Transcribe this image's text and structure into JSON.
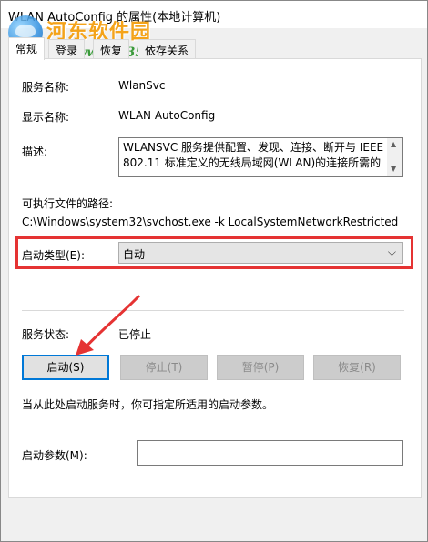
{
  "window": {
    "title": "WLAN AutoConfig 的属性(本地计算机)"
  },
  "watermark": {
    "name": "河东软件园",
    "url": "www.pc0359.cn"
  },
  "tabs": [
    {
      "label": "常规"
    },
    {
      "label": "登录"
    },
    {
      "label": "恢复"
    },
    {
      "label": "依存关系"
    }
  ],
  "general": {
    "service_name_label": "服务名称:",
    "service_name_value": "WlanSvc",
    "display_name_label": "显示名称:",
    "display_name_value": "WLAN AutoConfig",
    "description_label": "描述:",
    "description_value": "WLANSVC 服务提供配置、发现、连接、断开与 IEEE 802.11 标准定义的无线局域网(WLAN)的连接所需的",
    "exe_path_label": "可执行文件的路径:",
    "exe_path_value": "C:\\Windows\\system32\\svchost.exe -k LocalSystemNetworkRestricted",
    "startup_type_label": "启动类型(E):",
    "startup_type_value": "自动",
    "service_status_label": "服务状态:",
    "service_status_value": "已停止",
    "hint_text": "当从此处启动服务时，你可指定所适用的启动参数。",
    "start_params_label": "启动参数(M):",
    "start_params_value": ""
  },
  "buttons": {
    "start": "启动(S)",
    "stop": "停止(T)",
    "pause": "暂停(P)",
    "resume": "恢复(R)"
  },
  "colors": {
    "highlight": "#e53333",
    "arrow": "#e53333"
  }
}
